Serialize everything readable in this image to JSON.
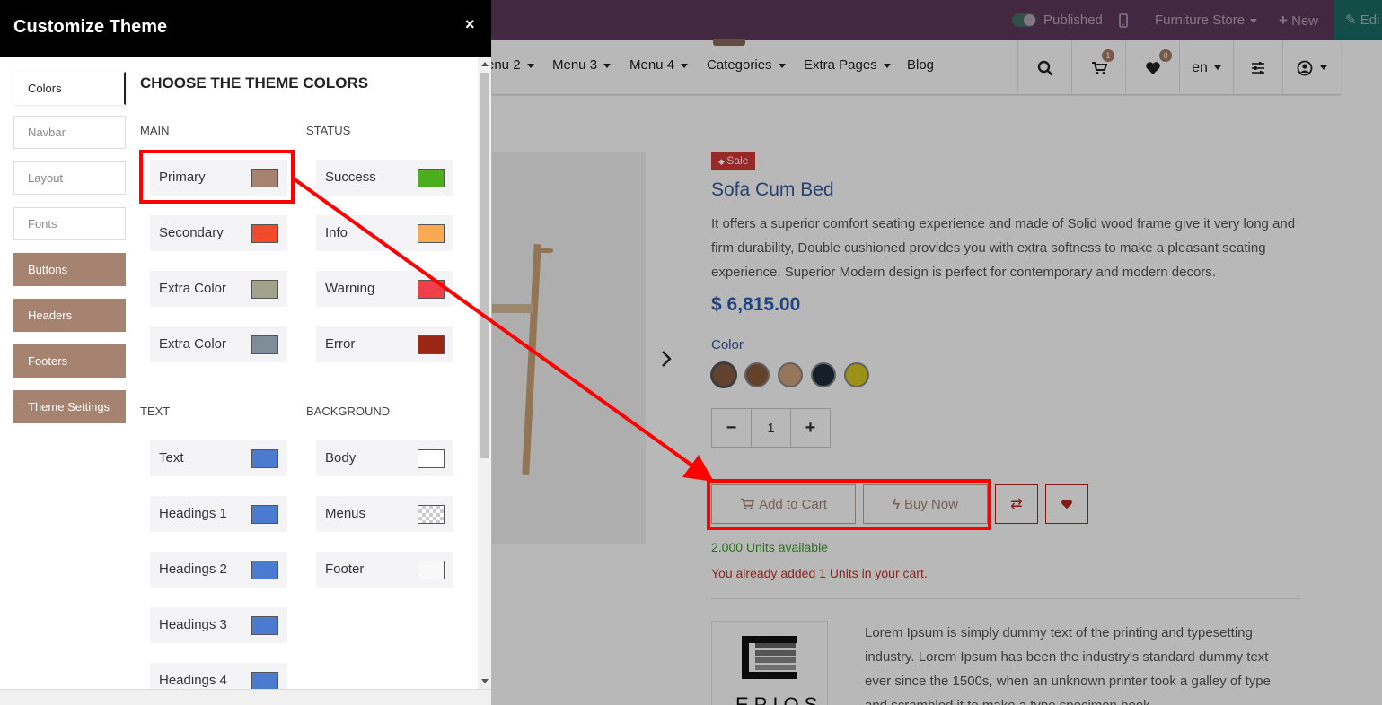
{
  "topbar": {
    "published_label": "Published",
    "store_label": "Furniture Store",
    "new_label": "New",
    "edit_label": "Edi"
  },
  "menubar": {
    "items": [
      "enu 2",
      "Menu 3",
      "Menu 4",
      "Categories",
      "Extra Pages",
      "Blog"
    ],
    "cart_count": "1",
    "wishlist_count": "0",
    "language": "en"
  },
  "product": {
    "sale_label": "Sale",
    "title": "Sofa Cum Bed",
    "description": "It offers a superior comfort seating experience and made of Solid wood frame give it very long and firm durability, Double cushioned provides you with extra softness to make a pleasant seating experience. Superior Modern design is perfect for contemporary and modern decors.",
    "price": "$ 6,815.00",
    "color_label": "Color",
    "swatch_colors": [
      "#8a5a44",
      "#8a5a3c",
      "#d1a57f",
      "#1f2a3a",
      "#d9c91f"
    ],
    "quantity": "1",
    "minus_label": "−",
    "plus_label": "+",
    "add_to_cart_label": "Add to Cart",
    "buy_now_label": "Buy Now",
    "units_available": "2.000 Units available",
    "cart_note": "You already added 1 Units in your cart.",
    "brand_text": "Lorem Ipsum is simply dummy text of the printing and typesetting industry. Lorem Ipsum has been the industry's standard dummy text ever since the 1500s, when an unknown printer took a galley of type and scrambled it to make a type specimen book.",
    "brand_logo_text": "EPIOS"
  },
  "panel": {
    "title": "Customize Theme",
    "close_label": "×",
    "tabs": [
      "Colors",
      "Navbar",
      "Layout",
      "Fonts",
      "Buttons",
      "Headers",
      "Footers",
      "Theme Settings"
    ],
    "heading": "CHOOSE THE THEME COLORS",
    "groups": {
      "main": {
        "label": "MAIN",
        "items": [
          {
            "label": "Primary",
            "color": "#a68371"
          },
          {
            "label": "Secondary",
            "color": "#f24a2c"
          },
          {
            "label": "Extra Color",
            "color": "#a0a38a"
          },
          {
            "label": "Extra Color",
            "color": "#7d8e9a"
          }
        ]
      },
      "status": {
        "label": "STATUS",
        "items": [
          {
            "label": "Success",
            "color": "#4cae1f"
          },
          {
            "label": "Info",
            "color": "#f9a854"
          },
          {
            "label": "Warning",
            "color": "#f03e4d"
          },
          {
            "label": "Error",
            "color": "#9c2614"
          }
        ]
      },
      "text": {
        "label": "TEXT",
        "items": [
          {
            "label": "Text",
            "color": "#4a7bd0"
          },
          {
            "label": "Headings 1",
            "color": "#4a7bd0"
          },
          {
            "label": "Headings 2",
            "color": "#4a7bd0"
          },
          {
            "label": "Headings 3",
            "color": "#4a7bd0"
          },
          {
            "label": "Headings 4",
            "color": "#4a7bd0"
          }
        ]
      },
      "background": {
        "label": "BACKGROUND",
        "items": [
          {
            "label": "Body",
            "color": "#ffffff"
          },
          {
            "label": "Menus",
            "color": "transparent"
          },
          {
            "label": "Footer",
            "color": "#f8f8f8"
          }
        ]
      }
    }
  },
  "annotation": {
    "color": "#ff0000"
  }
}
